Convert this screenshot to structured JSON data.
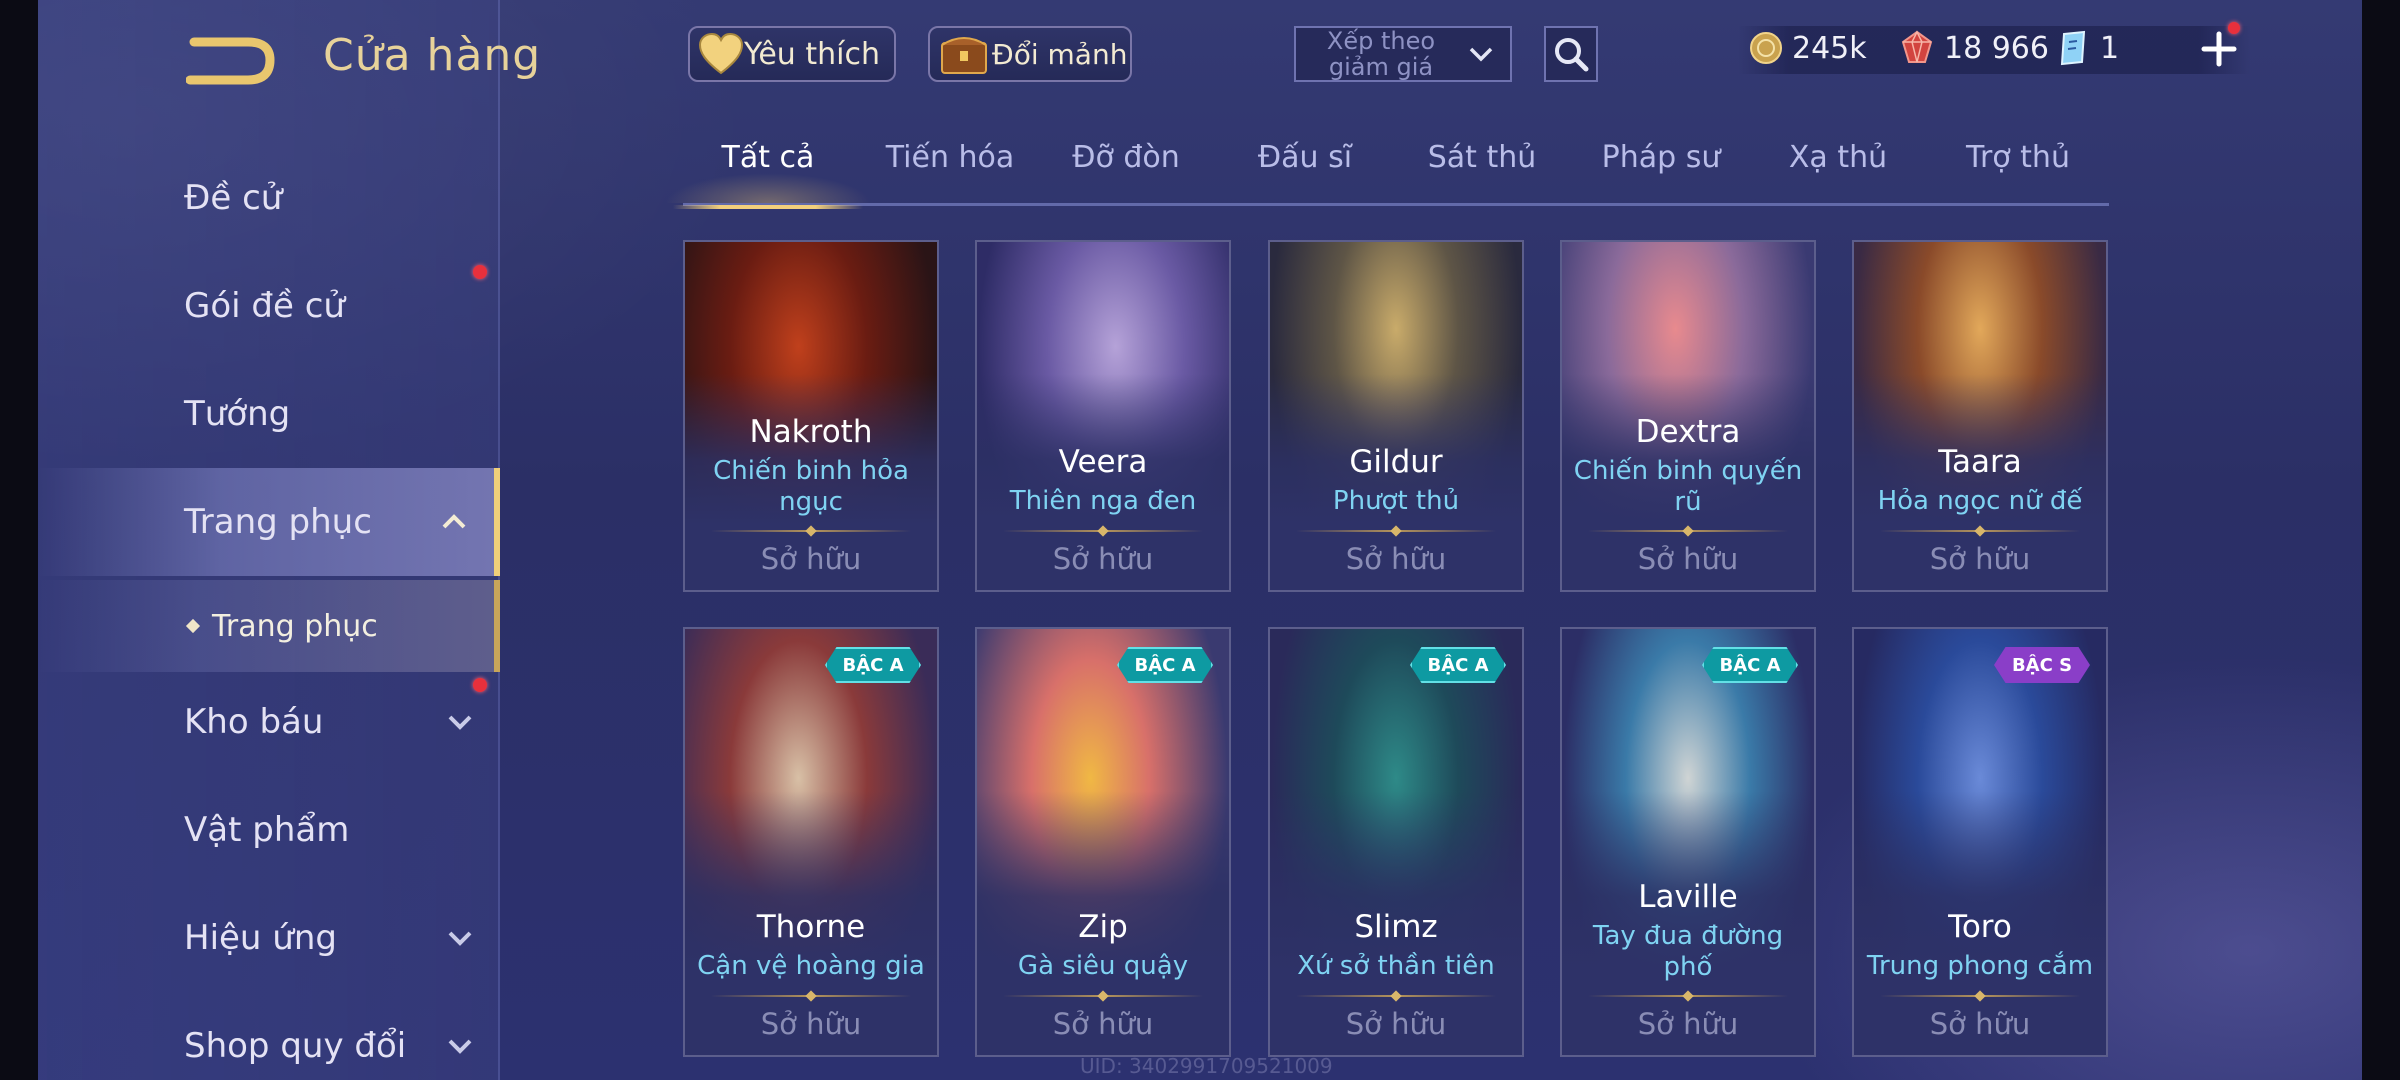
{
  "header": {
    "title": "Cửa hàng",
    "favorites_label": "Yêu thích",
    "exchange_label": "Đổi mảnh",
    "sort_label": "Xếp theo giảm giá",
    "gold": "245k",
    "gems": "18 966",
    "vouchers": "1"
  },
  "sidebar": {
    "items": [
      {
        "label": "Đề cử"
      },
      {
        "label": "Gói đề cử"
      },
      {
        "label": "Tướng"
      },
      {
        "label": "Trang phục"
      },
      {
        "label": "Kho báu"
      },
      {
        "label": "Vật phẩm"
      },
      {
        "label": "Hiệu ứng"
      },
      {
        "label": "Shop quy đổi"
      }
    ],
    "sub_item": "Trang phục"
  },
  "tabs": [
    "Tất cả",
    "Tiến hóa",
    "Đỡ đòn",
    "Đấu sĩ",
    "Sát thủ",
    "Pháp sư",
    "Xạ thủ",
    "Trợ thủ"
  ],
  "active_tab": "Tất cả",
  "cards": [
    {
      "hero": "Nakroth",
      "skin": "Chiến binh hỏa ngục",
      "status": "Sở hữu",
      "badge": ""
    },
    {
      "hero": "Veera",
      "skin": "Thiên nga đen",
      "status": "Sở hữu",
      "badge": ""
    },
    {
      "hero": "Gildur",
      "skin": "Phượt thủ",
      "status": "Sở hữu",
      "badge": ""
    },
    {
      "hero": "Dextra",
      "skin": "Chiến binh quyến rũ",
      "status": "Sở hữu",
      "badge": ""
    },
    {
      "hero": "Taara",
      "skin": "Hỏa ngọc nữ đế",
      "status": "Sở hữu",
      "badge": ""
    },
    {
      "hero": "Thorne",
      "skin": "Cận vệ hoàng gia",
      "status": "Sở hữu",
      "badge": "BẬC A"
    },
    {
      "hero": "Zip",
      "skin": "Gà siêu quậy",
      "status": "Sở hữu",
      "badge": "BẬC A"
    },
    {
      "hero": "Slimz",
      "skin": "Xứ sở thần tiên",
      "status": "Sở hữu",
      "badge": "BẬC A"
    },
    {
      "hero": "Laville",
      "skin": "Tay đua đường phố",
      "status": "Sở hữu",
      "badge": "BẬC A"
    },
    {
      "hero": "Toro",
      "skin": "Trung phong cắm",
      "status": "Sở hữu",
      "badge": "BẬC S"
    }
  ],
  "footer": {
    "uid": "UID: 3402991709521009"
  },
  "colors": {
    "accent_gold": "#f2cf7c",
    "skin_name": "#7fd3f2",
    "badge_a": "#0e9aa2",
    "badge_s": "#8a3ec8",
    "notification": "#e8303c"
  },
  "icons": [
    "back-arrow-icon",
    "heart-icon",
    "chest-icon",
    "chevron-down-icon",
    "search-icon",
    "gold-coin-icon",
    "ruby-icon",
    "voucher-icon",
    "plus-icon",
    "chevron-up-icon"
  ]
}
